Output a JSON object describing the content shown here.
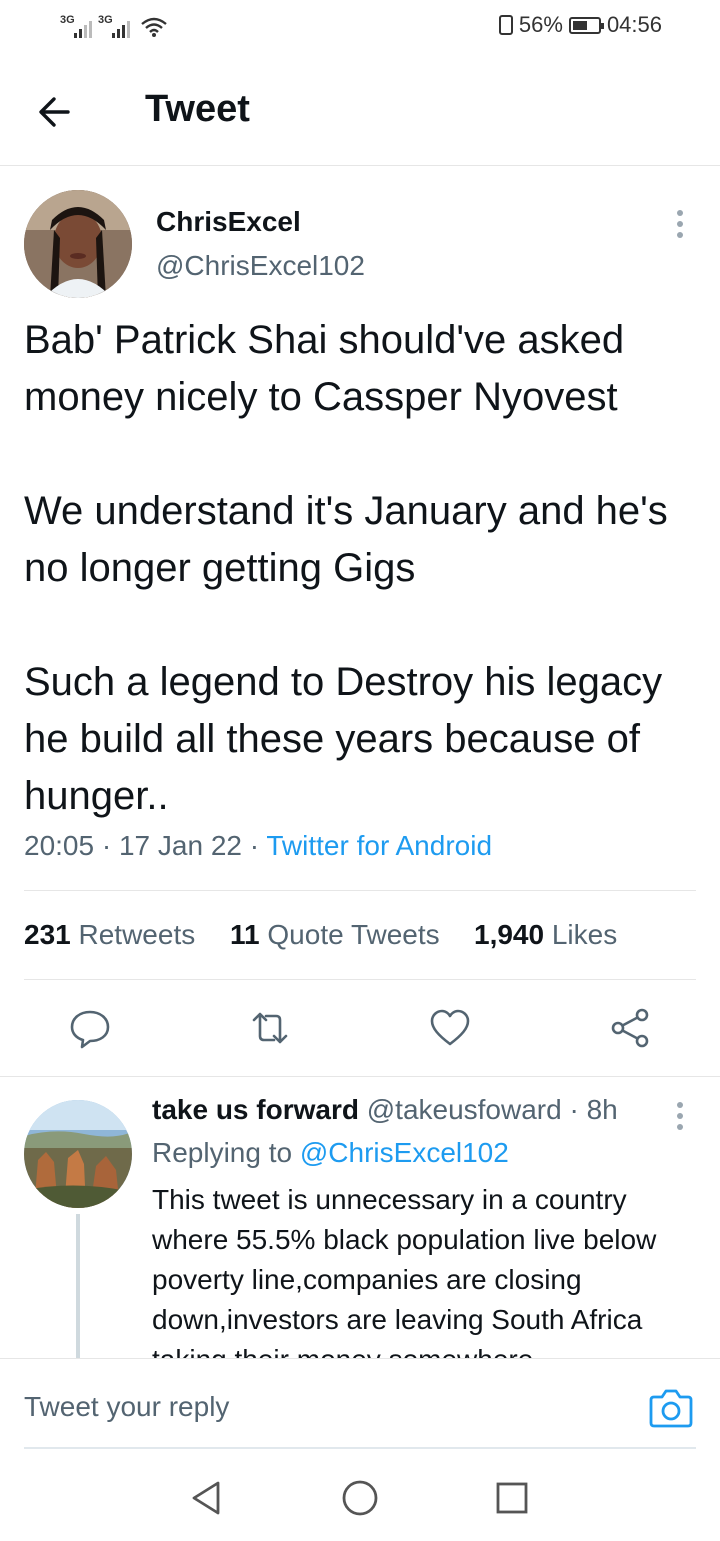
{
  "status_bar": {
    "sim1": "3G",
    "sim2": "3G",
    "battery_percent": "56%",
    "time": "04:56"
  },
  "header": {
    "title": "Tweet"
  },
  "tweet": {
    "author_name": "ChrisExcel",
    "author_handle": "@ChrisExcel102",
    "paragraphs": [
      "Bab' Patrick Shai should've asked money nicely to Cassper Nyovest",
      "We understand it's January and he's no longer getting Gigs",
      "Such a legend to Destroy his legacy he build all these years because of hunger.."
    ],
    "time": "20:05",
    "date": "17 Jan 22",
    "source": "Twitter for Android",
    "retweets_count": "231",
    "retweets_label": "Retweets",
    "quotes_count": "11",
    "quotes_label": "Quote Tweets",
    "likes_count": "1,940",
    "likes_label": "Likes"
  },
  "reply": {
    "author_name": "take us forward",
    "author_handle": "@takeusfoward",
    "age": "8h",
    "replying_label": "Replying to",
    "replying_to": "@ChrisExcel102",
    "text": "This tweet is unnecessary in a country where 55.5% black population live below poverty line,companies are closing down,investors are leaving South Africa taking their money somewhere"
  },
  "composer": {
    "placeholder": "Tweet your reply"
  },
  "colors": {
    "accent": "#1d9bf0",
    "secondary_text": "#536471",
    "primary_text": "#0f1419"
  },
  "icons": [
    "back-arrow-icon",
    "more-vertical-icon",
    "reply-icon",
    "retweet-icon",
    "like-icon",
    "share-icon",
    "camera-icon",
    "nav-back-icon",
    "nav-home-icon",
    "nav-recents-icon"
  ]
}
